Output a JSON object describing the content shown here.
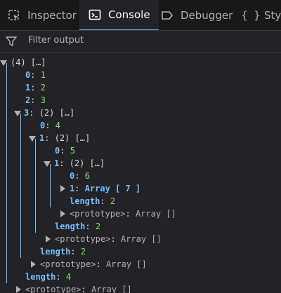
{
  "toolbar": {
    "tabs": [
      {
        "label": "Inspector",
        "icon": "inspector-icon"
      },
      {
        "label": "Console",
        "icon": "console-icon",
        "active": true
      },
      {
        "label": "Debugger",
        "icon": "debugger-icon"
      },
      {
        "label": "Style",
        "icon": "style-editor-icon"
      }
    ]
  },
  "filter": {
    "placeholder": "Filter output"
  },
  "tree": {
    "root": "(4) […]",
    "r0k": "0",
    "r0v": "1",
    "r1k": "1",
    "r1v": "2",
    "r2k": "2",
    "r2v": "3",
    "r3k": "3",
    "r3v": "(2) […]",
    "r3_0k": "0",
    "r3_0v": "4",
    "r3_1k": "1",
    "r3_1v": "(2) […]",
    "r3_1_0k": "0",
    "r3_1_0v": "5",
    "r3_1_1k": "1",
    "r3_1_1v": "(2) […]",
    "r3_1_1_0k": "0",
    "r3_1_1_0v": "6",
    "r3_1_1_1k": "1",
    "r3_1_1_1v": "Array [ 7 ]",
    "length_key": "length",
    "len_inner": "2",
    "len_mid": "2",
    "len_outer": "2",
    "len_root": "4",
    "proto_key": "<prototype>",
    "proto_val": "Array []"
  }
}
